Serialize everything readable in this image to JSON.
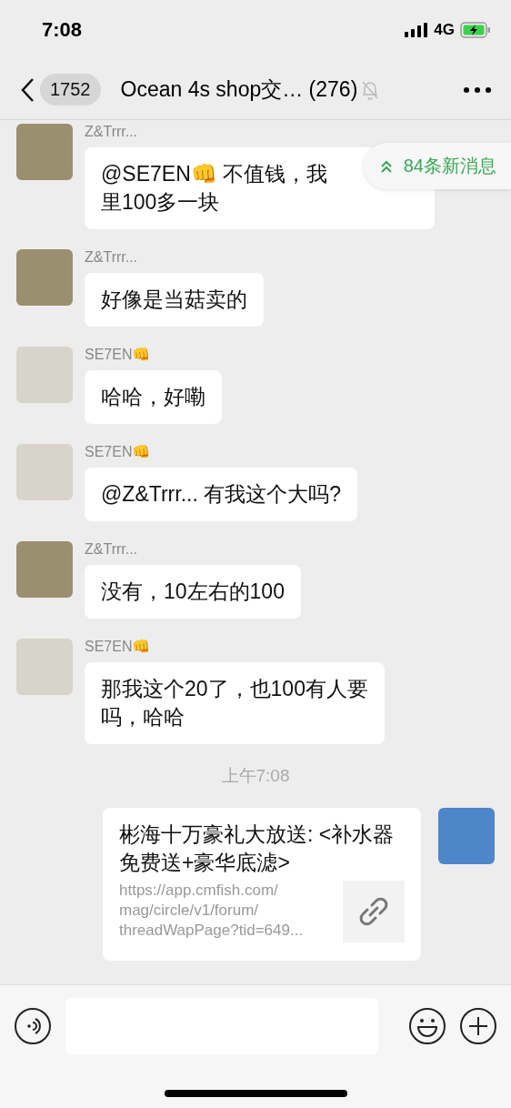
{
  "status_bar": {
    "time": "7:08",
    "network": "4G"
  },
  "header": {
    "back_count": "1752",
    "title": "Ocean 4s shop交… (276)",
    "muted": true
  },
  "new_messages_pill": {
    "label": "84条新消息"
  },
  "messages": [
    {
      "kind": "text",
      "avatar": {
        "kind": "photo"
      },
      "sender": "Z&Trrr...",
      "lines": [
        "@SE7EN👊 不值钱，我",
        "里100多一块"
      ]
    },
    {
      "kind": "text",
      "avatar": {
        "kind": "photo"
      },
      "sender": "Z&Trrr...",
      "lines": [
        "好像是当菇卖的"
      ]
    },
    {
      "kind": "text",
      "avatar": {
        "kind": "logo"
      },
      "sender": "SE7EN👊",
      "lines": [
        "哈哈，好嘞"
      ]
    },
    {
      "kind": "text",
      "avatar": {
        "kind": "logo"
      },
      "sender": "SE7EN👊",
      "lines": [
        "@Z&Trrr... 有我这个大吗?"
      ]
    },
    {
      "kind": "text",
      "avatar": {
        "kind": "photo"
      },
      "sender": "Z&Trrr...",
      "lines": [
        "没有，10左右的100"
      ]
    },
    {
      "kind": "text",
      "avatar": {
        "kind": "logo"
      },
      "sender": "SE7EN👊",
      "lines": [
        "那我这个20了，也100有人要",
        "吗，哈哈"
      ]
    },
    {
      "kind": "time",
      "label": "上午7:08"
    },
    {
      "kind": "link",
      "avatar": {
        "kind": "sky"
      },
      "title": "彬海十万豪礼大放送: <补水器免费送+豪华底滤>",
      "url": "https://app.cmfish.com/ mag/circle/v1/forum/ threadWapPage?tid=649..."
    }
  ]
}
